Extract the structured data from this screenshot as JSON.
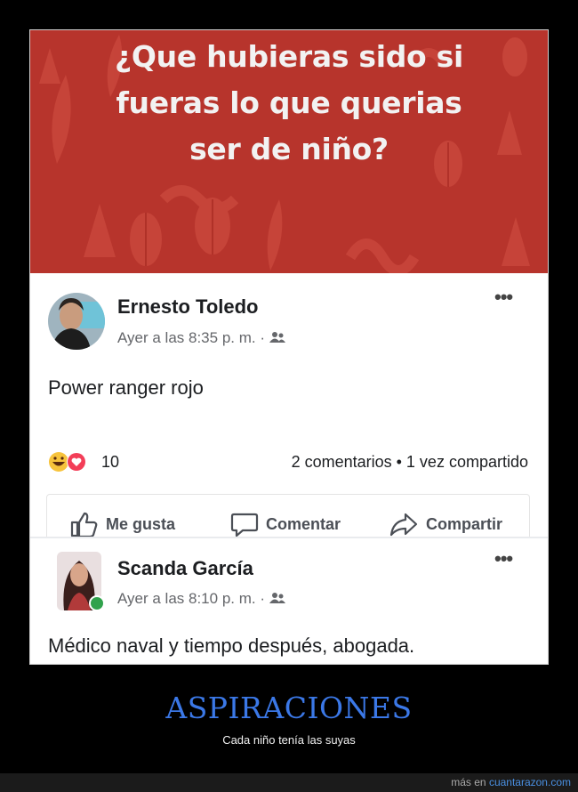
{
  "banner": {
    "question": "¿Que hubieras sido si\nfueras lo que querias\nser de niño?"
  },
  "post1": {
    "author": "Ernesto Toledo",
    "timestamp": "Ayer a las 8:35 p. m. ·",
    "text": "Power ranger rojo",
    "reaction_count": "10",
    "stats": "2 comentarios • 1 vez compartido",
    "actions": {
      "like": "Me gusta",
      "comment": "Comentar",
      "share": "Compartir"
    }
  },
  "post2": {
    "author": "Scanda García",
    "timestamp": "Ayer a las 8:10 p. m. ·",
    "text": "Médico naval y tiempo después, abogada."
  },
  "caption": {
    "title": "ASPIRACIONES",
    "subtitle": "Cada niño tenía las suyas"
  },
  "footer": {
    "prefix": "más en",
    "link": "cuantarazon.com"
  },
  "colors": {
    "banner_bg": "#b7342c",
    "caption_title": "#3b78e7",
    "online_dot": "#31a24c"
  }
}
